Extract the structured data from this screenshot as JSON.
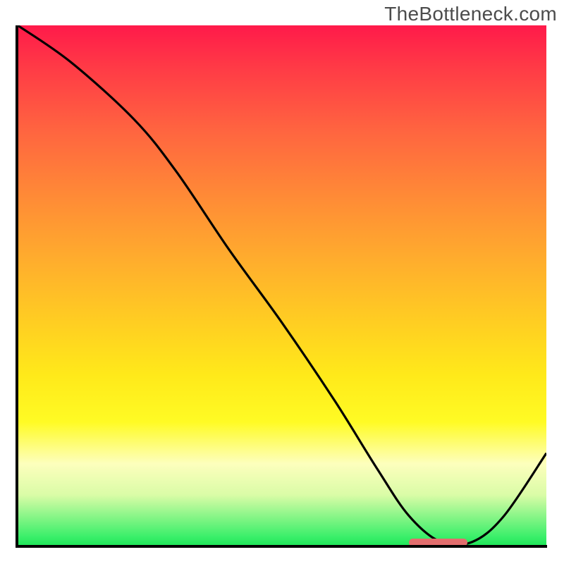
{
  "watermark": "TheBottleneck.com",
  "chart_data": {
    "type": "line",
    "title": "",
    "xlabel": "",
    "ylabel": "",
    "xlim": [
      0,
      100
    ],
    "ylim": [
      0,
      100
    ],
    "grid": false,
    "series": [
      {
        "name": "bottleneck-curve",
        "x": [
          0,
          10,
          22,
          30,
          40,
          50,
          60,
          68,
          74,
          80,
          86,
          92,
          100
        ],
        "y": [
          100,
          93,
          82,
          72,
          57,
          43,
          28,
          15,
          6,
          1,
          1,
          6,
          18
        ]
      }
    ],
    "annotations": [
      {
        "name": "optimal-marker",
        "x_start": 74,
        "x_end": 85,
        "y": 0.8
      }
    ],
    "background_gradient": {
      "top_color": "#ff1a4a",
      "mid_color": "#ffe91a",
      "bottom_color": "#1ae556"
    }
  }
}
